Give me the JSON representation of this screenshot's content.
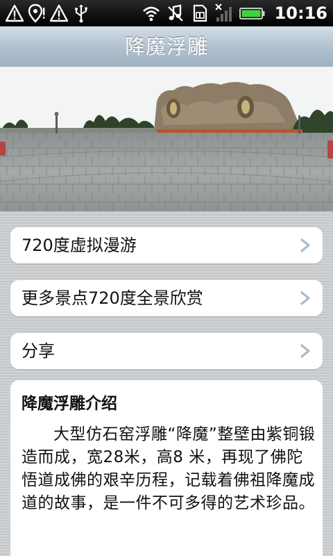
{
  "status_bar": {
    "time": "10:16",
    "left_icons": [
      "warning-icon",
      "location-pin-icon",
      "warning-icon",
      "usb-icon"
    ],
    "right_icons": [
      "wifi-icon",
      "music-off-icon",
      "sim-icon",
      "signal-icon",
      "battery-icon"
    ]
  },
  "header": {
    "title": "降魔浮雕"
  },
  "menu": {
    "items": [
      {
        "label": "720度虚拟漫游",
        "icon": "chevron-right-icon"
      },
      {
        "label": "更多景点720度全景欣赏",
        "icon": "chevron-right-icon"
      },
      {
        "label": "分享",
        "icon": "chevron-right-icon"
      }
    ]
  },
  "intro": {
    "title": "降魔浮雕介绍",
    "body": "大型仿石窑浮雕“降魔”整壁由紫铜锻造而成，宽28米，高8 米，再现了佛陀悟道成佛的艰辛历程，记载着佛祖降魔成道的故事，是一件不可多得的艺术珍品。"
  },
  "colors": {
    "title_bar": "#b2c2d0",
    "background": "#c7cbcd",
    "card": "#ffffff",
    "chevron": "#a9b9c8"
  }
}
